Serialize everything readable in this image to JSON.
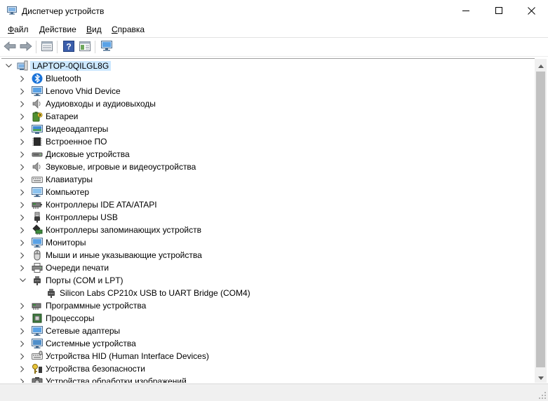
{
  "window": {
    "title": "Диспетчер устройств",
    "controls": {
      "minimize": "minimize-icon",
      "maximize": "maximize-icon",
      "close": "close-icon"
    }
  },
  "menu": {
    "items": [
      {
        "label": "Файл",
        "accel": "Ф",
        "rest": "айл"
      },
      {
        "label": "Действие",
        "accel": "Д",
        "rest": "ействие"
      },
      {
        "label": "Вид",
        "accel": "В",
        "rest": "ид"
      },
      {
        "label": "Справка",
        "accel": "С",
        "rest": "правка"
      }
    ]
  },
  "toolbar": {
    "buttons": [
      "back-arrow-icon",
      "forward-arrow-icon",
      "properties-grid-icon",
      "help-icon",
      "view-panel-icon",
      "scan-hardware-monitor-icon"
    ]
  },
  "tree": {
    "root": {
      "label": "LAPTOP-0QILGL8G",
      "icon": "computer-root-icon",
      "expanded": true
    },
    "items": [
      {
        "label": "Bluetooth",
        "icon": "bluetooth-icon",
        "expanded": false,
        "children": []
      },
      {
        "label": "Lenovo Vhid Device",
        "icon": "monitor-icon",
        "expanded": false,
        "children": []
      },
      {
        "label": "Аудиовходы и аудиовыходы",
        "icon": "speaker-icon",
        "expanded": false,
        "children": []
      },
      {
        "label": "Батареи",
        "icon": "battery-icon",
        "expanded": false,
        "children": []
      },
      {
        "label": "Видеоадаптеры",
        "icon": "display-adapter-icon",
        "expanded": false,
        "children": []
      },
      {
        "label": "Встроенное ПО",
        "icon": "firmware-chip-icon",
        "expanded": false,
        "children": []
      },
      {
        "label": "Дисковые устройства",
        "icon": "disk-drive-icon",
        "expanded": false,
        "children": []
      },
      {
        "label": "Звуковые, игровые и видеоустройства",
        "icon": "sound-device-icon",
        "expanded": false,
        "children": []
      },
      {
        "label": "Клавиатуры",
        "icon": "keyboard-icon",
        "expanded": false,
        "children": []
      },
      {
        "label": "Компьютер",
        "icon": "computer-icon",
        "expanded": false,
        "children": []
      },
      {
        "label": "Контроллеры IDE ATA/ATAPI",
        "icon": "ide-controller-icon",
        "expanded": false,
        "children": []
      },
      {
        "label": "Контроллеры USB",
        "icon": "usb-icon",
        "expanded": false,
        "children": []
      },
      {
        "label": "Контроллеры запоминающих устройств",
        "icon": "storage-controller-icon",
        "expanded": false,
        "children": []
      },
      {
        "label": "Мониторы",
        "icon": "monitor-icon",
        "expanded": false,
        "children": []
      },
      {
        "label": "Мыши и иные указывающие устройства",
        "icon": "mouse-icon",
        "expanded": false,
        "children": []
      },
      {
        "label": "Очереди печати",
        "icon": "printer-icon",
        "expanded": false,
        "children": []
      },
      {
        "label": "Порты (COM и LPT)",
        "icon": "port-icon",
        "expanded": true,
        "children": [
          {
            "label": "Silicon Labs CP210x USB to UART Bridge (COM4)",
            "icon": "port-icon"
          }
        ]
      },
      {
        "label": "Программные устройства",
        "icon": "software-device-icon",
        "expanded": false,
        "children": []
      },
      {
        "label": "Процессоры",
        "icon": "processor-icon",
        "expanded": false,
        "children": []
      },
      {
        "label": "Сетевые адаптеры",
        "icon": "network-adapter-icon",
        "expanded": false,
        "children": []
      },
      {
        "label": "Системные устройства",
        "icon": "system-device-icon",
        "expanded": false,
        "children": []
      },
      {
        "label": "Устройства HID (Human Interface Devices)",
        "icon": "hid-icon",
        "expanded": false,
        "children": []
      },
      {
        "label": "Устройства безопасности",
        "icon": "security-device-icon",
        "expanded": false,
        "children": []
      },
      {
        "label": "Устройства обработки изображений",
        "icon": "imaging-device-icon",
        "expanded": false,
        "children": []
      }
    ]
  },
  "colors": {
    "selection": "#cce8ff",
    "accent": "#0078d7"
  }
}
